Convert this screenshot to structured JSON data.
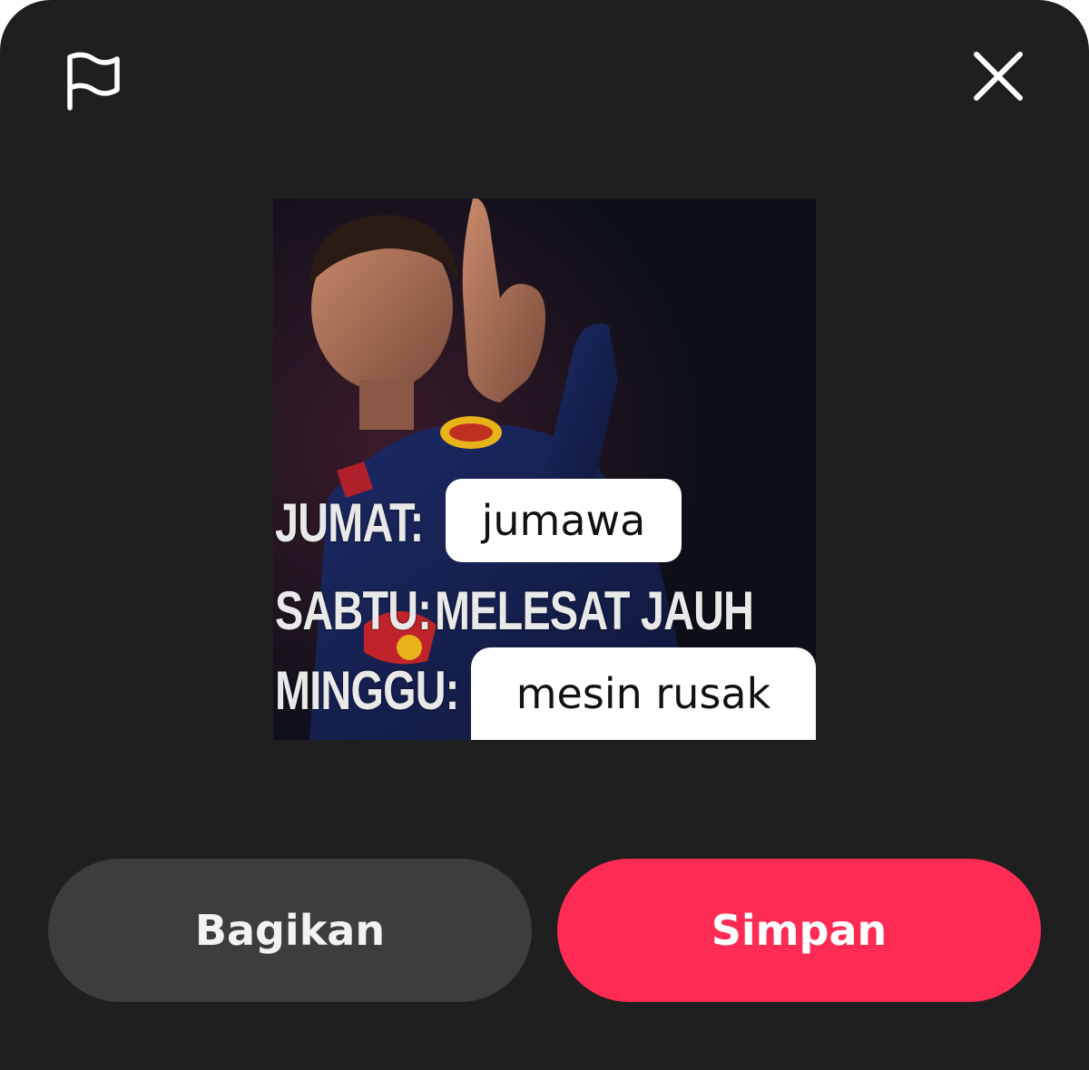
{
  "header": {
    "report_icon": "flag-icon",
    "close_icon": "close-icon"
  },
  "sticker": {
    "line1_label": "JUMAT:",
    "line1_bubble": "jumawa",
    "line2_label": "SABTU:",
    "line2_text": "MELESAT JAUH",
    "line3_label": "MINGGU:",
    "line3_bubble": "mesin rusak"
  },
  "actions": {
    "share_label": "Bagikan",
    "save_label": "Simpan"
  },
  "colors": {
    "sheet_bg": "#1f1f1f",
    "share_bg": "#3d3d3d",
    "save_bg": "#fe2c55"
  }
}
